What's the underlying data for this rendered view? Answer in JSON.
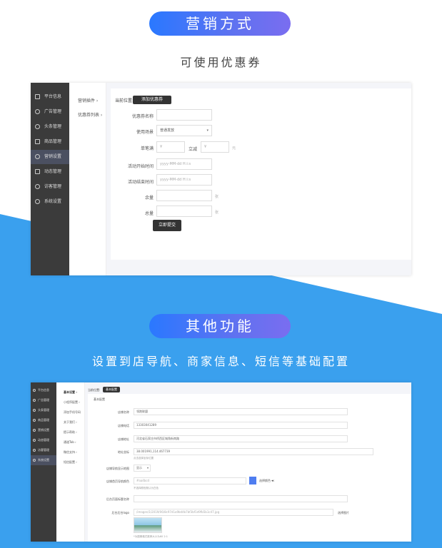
{
  "sections": [
    {
      "title": "营销方式",
      "subtitle": "可使用优惠券"
    },
    {
      "title": "其他功能",
      "subtitle": "设置到店导航、商家信息、短信等基础配置"
    }
  ],
  "colors": {
    "accent": "#2a78ff",
    "blue_bg": "#3aa0ee",
    "sidebar": "#3b3b3b",
    "sidebar_active": "#4b5061"
  },
  "shot1": {
    "sidebar": [
      {
        "label": "平台信息",
        "icon": "monitor-icon"
      },
      {
        "label": "广告管理",
        "icon": "target-icon"
      },
      {
        "label": "头条管理",
        "icon": "compass-icon"
      },
      {
        "label": "商品管理",
        "icon": "cart-icon"
      },
      {
        "label": "营销设置",
        "icon": "gift-icon"
      },
      {
        "label": "动态管理",
        "icon": "comment-icon"
      },
      {
        "label": "访客管理",
        "icon": "user-icon"
      },
      {
        "label": "系统设置",
        "icon": "gear-icon"
      }
    ],
    "submenu": [
      "营销插件  ›",
      "优惠券列表  ›"
    ],
    "crumb": "当前位置:",
    "crumb_button": "添加优惠券",
    "form": {
      "name_label": "优惠券名称",
      "scene_label": "使用场景",
      "scene_value": "普通发放",
      "threshold_label": "单笔满",
      "threshold_prefix": "¥",
      "reduce_label": "立减",
      "reduce_prefix": "¥",
      "yuan": "元",
      "start_label": "活动开始时间",
      "start_placeholder": "yyyy-MM-dd H:i:s",
      "end_label": "活动结束时间",
      "end_placeholder": "yyyy-MM-dd H:i:s",
      "remain_label": "余量",
      "remain_unit": "张",
      "total_label": "总量",
      "total_unit": "张",
      "submit": "立即提交"
    }
  },
  "shot2": {
    "sidebar": [
      "平台信息",
      "广告管理",
      "头条管理",
      "商品管理",
      "营销设置",
      "动态管理",
      "访客管理",
      "系统设置"
    ],
    "submenu": [
      "基本设置  ›",
      "小程序配置  ›",
      "添加手机号码",
      "关于我们  ›",
      "提示帮助  ›",
      "通道Tab  ›",
      "微信支持  ›",
      "短信配置  ›"
    ],
    "crumb": "当前位置:",
    "crumb_button": "基本配置",
    "panel_title": "基本配置",
    "fields": [
      {
        "label": "店铺名称",
        "value": "领跑联盟"
      },
      {
        "label": "店铺电话",
        "value": "13303041289"
      },
      {
        "label": "店铺地址",
        "value": "河北省石家庄市桥西区城角街南路"
      },
      {
        "label": "地址坐标",
        "value": "38.001991,114.467739"
      },
      {
        "label": "店铺导航显示地图",
        "value": "显示"
      },
      {
        "label": "店铺首页导航颜色",
        "value": "#aa4bcd"
      },
      {
        "label": "后台页面标题名称",
        "value": ""
      },
      {
        "label": "后台后台logo",
        "value": "/images/1/2019/06/8c97d1a9bd4b7bf3bf1d9fb5b1c47.jpg"
      }
    ],
    "coord_hint": "点击选择坐标位置",
    "color_hint": "不选择颜色默认为白色",
    "color_pick": "选择颜色 ▾",
    "logo_button": "选择图片",
    "logo_hint": "*为图像格式推荐大小为60 2:1"
  }
}
